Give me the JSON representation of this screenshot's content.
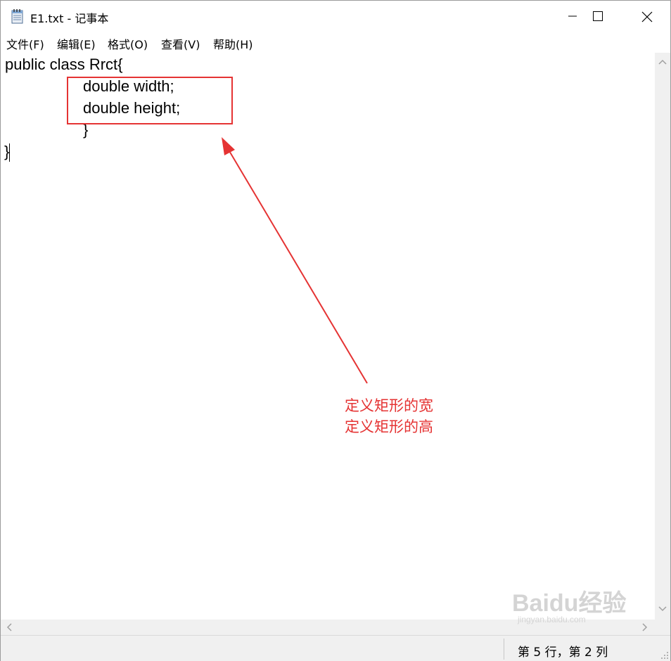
{
  "window": {
    "title": "E1.txt - 记事本",
    "icon": "notepad-icon",
    "controls": [
      "minimize-icon",
      "maximize-icon",
      "close-icon"
    ]
  },
  "menu": [
    {
      "label": "文件(F)"
    },
    {
      "label": "编辑(E)"
    },
    {
      "label": "格式(O)"
    },
    {
      "label": "查看(V)"
    },
    {
      "label": "帮助(H)"
    }
  ],
  "editor": {
    "lines": [
      "public class Rrct{",
      "double width;",
      "double height;",
      "}",
      "}"
    ]
  },
  "annotation": {
    "lines": [
      "定义矩形的宽",
      "定义矩形的高"
    ],
    "color": "#e53333"
  },
  "status": {
    "position": "第 5 行，第 2 列"
  },
  "watermark": {
    "brand": "Baidu经验",
    "url": "jingyan.baidu.com"
  }
}
